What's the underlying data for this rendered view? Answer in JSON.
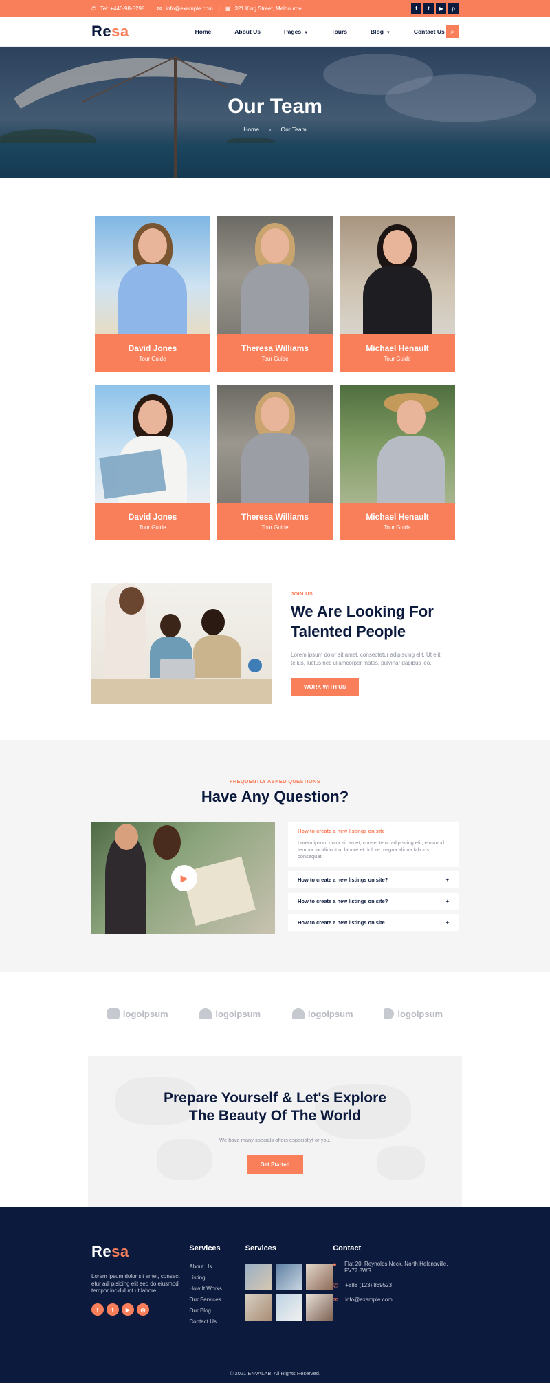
{
  "topbar": {
    "phone": "Tel: +440-98-5298",
    "email": "info@example.com",
    "address": "321 King Street, Melbourne",
    "social": [
      "f",
      "t",
      "yt",
      "p"
    ]
  },
  "nav": {
    "logo_a": "Re",
    "logo_b": "sa",
    "items": [
      {
        "label": "Home",
        "caret": false
      },
      {
        "label": "About Us",
        "caret": false
      },
      {
        "label": "Pages",
        "caret": true
      },
      {
        "label": "Tours",
        "caret": false
      },
      {
        "label": "Blog",
        "caret": true
      },
      {
        "label": "Contact Us",
        "caret": false
      }
    ]
  },
  "hero": {
    "title": "Our Team",
    "crumb_home": "Home",
    "crumb_sep": "›",
    "crumb_current": "Our Team"
  },
  "team": [
    {
      "name": "David Jones",
      "role": "Tour Guide"
    },
    {
      "name": "Theresa Williams",
      "role": "Tour Guide"
    },
    {
      "name": "Michael Henault",
      "role": "Tour Guide"
    },
    {
      "name": "David Jones",
      "role": "Tour Guide"
    },
    {
      "name": "Theresa Williams",
      "role": "Tour Guide"
    },
    {
      "name": "Michael Henault",
      "role": "Tour Guide"
    }
  ],
  "join": {
    "eyebrow": "JOIN US",
    "title": "We Are Looking For Talented People",
    "text": "Lorem ipsum dolor sit amet, consectetur adipiscing elit. Ut elit tellus, luctus nec ullamcorper mattis, pulvinar dapibus leo.",
    "button": "WORK WITH US"
  },
  "faq": {
    "eyebrow": "FREQUENTLY ASKED QUESTIONS",
    "title": "Have Any Question?",
    "items": [
      {
        "q": "How to create a new listings on site",
        "a": "Lorem ipsum dolor sit amet, consectetur adipiscing elit, eiusmod tempor incididunt ut labore et dolore magna aliqua laboris consequat.",
        "open": true,
        "icon": "−"
      },
      {
        "q": "How to create a new listings on site?",
        "a": "",
        "open": false,
        "icon": "+"
      },
      {
        "q": "How to create a new listings on site?",
        "a": "",
        "open": false,
        "icon": "+"
      },
      {
        "q": "How to create a new listings on site",
        "a": "",
        "open": false,
        "icon": "+"
      }
    ]
  },
  "logos": [
    "logoipsum",
    "logoipsum",
    "logoipsum",
    "logoipsum"
  ],
  "cta": {
    "title_line1": "Prepare Yourself & Let's Explore",
    "title_line2": "The Beauty Of The World",
    "text": "We have many specials offers especiallyf or you.",
    "button": "Get Started"
  },
  "footer": {
    "logo_a": "Re",
    "logo_b": "sa",
    "about": "Lorem ipsum dolor sit amet, consect etur adi pisicing elit sed do eiusmod tempor incididunt ut labore.",
    "social": [
      "f",
      "t",
      "yt",
      "ig"
    ],
    "col2_title": "Services",
    "col2_links": [
      "About Us",
      "Listing",
      "How It Works",
      "Our Services",
      "Our Blog",
      "Contact Us"
    ],
    "col3_title": "Services",
    "col4_title": "Contact",
    "address": "Flat 20, Reynolds Neck, North Helenaville, FV77 8WS",
    "phone": "+888 (123) 869523",
    "email": "info@example.com",
    "copyright": "© 2021 ENVALAB. All Rights Reserved."
  },
  "colors": {
    "accent": "#f97f5b",
    "navy": "#0c1a3d"
  }
}
